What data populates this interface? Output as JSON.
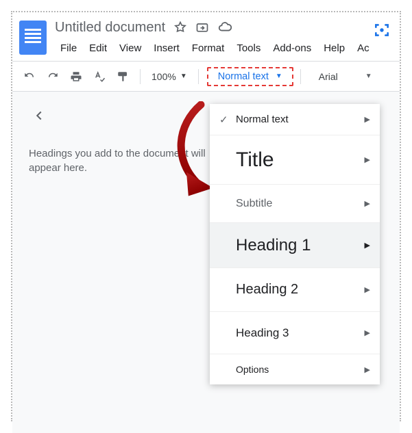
{
  "header": {
    "title": "Untitled document"
  },
  "menus": [
    "File",
    "Edit",
    "View",
    "Insert",
    "Format",
    "Tools",
    "Add-ons",
    "Help",
    "Ac"
  ],
  "toolbar": {
    "zoom": "100%",
    "styles_label": "Normal text",
    "font_label": "Arial"
  },
  "outline": {
    "placeholder": "Headings you add to the document will appear here."
  },
  "styles_menu": [
    {
      "key": "normal",
      "label": "Normal text",
      "checked": true
    },
    {
      "key": "title",
      "label": "Title",
      "checked": false
    },
    {
      "key": "subtitle",
      "label": "Subtitle",
      "checked": false
    },
    {
      "key": "h1",
      "label": "Heading 1",
      "checked": false,
      "active": true
    },
    {
      "key": "h2",
      "label": "Heading 2",
      "checked": false
    },
    {
      "key": "h3",
      "label": "Heading 3",
      "checked": false
    },
    {
      "key": "options",
      "label": "Options",
      "checked": false
    }
  ]
}
